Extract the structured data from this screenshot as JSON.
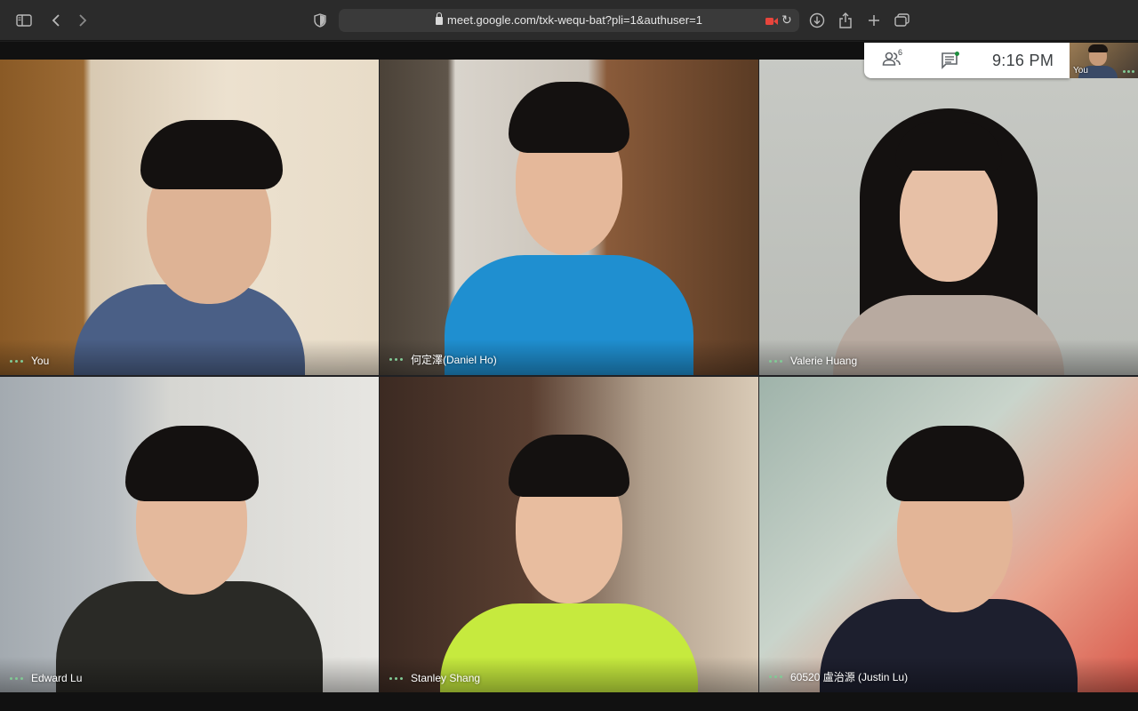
{
  "browser": {
    "url": "meet.google.com/txk-wequ-bat?pli=1&authuser=1",
    "icons": [
      "sidebar-icon",
      "back-icon",
      "forward-icon",
      "shield-icon",
      "lock-icon",
      "camera-recording-icon",
      "reload-icon",
      "download-icon",
      "share-icon",
      "new-tab-icon",
      "tabs-overview-icon"
    ]
  },
  "meeting": {
    "participant_count": "6",
    "time": "9:16  PM",
    "self_label": "You",
    "accent_active_color": "#81c995",
    "camera_indicator_color": "#e8453c"
  },
  "participants": [
    {
      "name": "You"
    },
    {
      "name": "何定澤(Daniel Ho)"
    },
    {
      "name": "Valerie Huang"
    },
    {
      "name": "Edward Lu"
    },
    {
      "name": "Stanley Shang"
    },
    {
      "name": "60520 盧治源 (Justin Lu)"
    }
  ]
}
